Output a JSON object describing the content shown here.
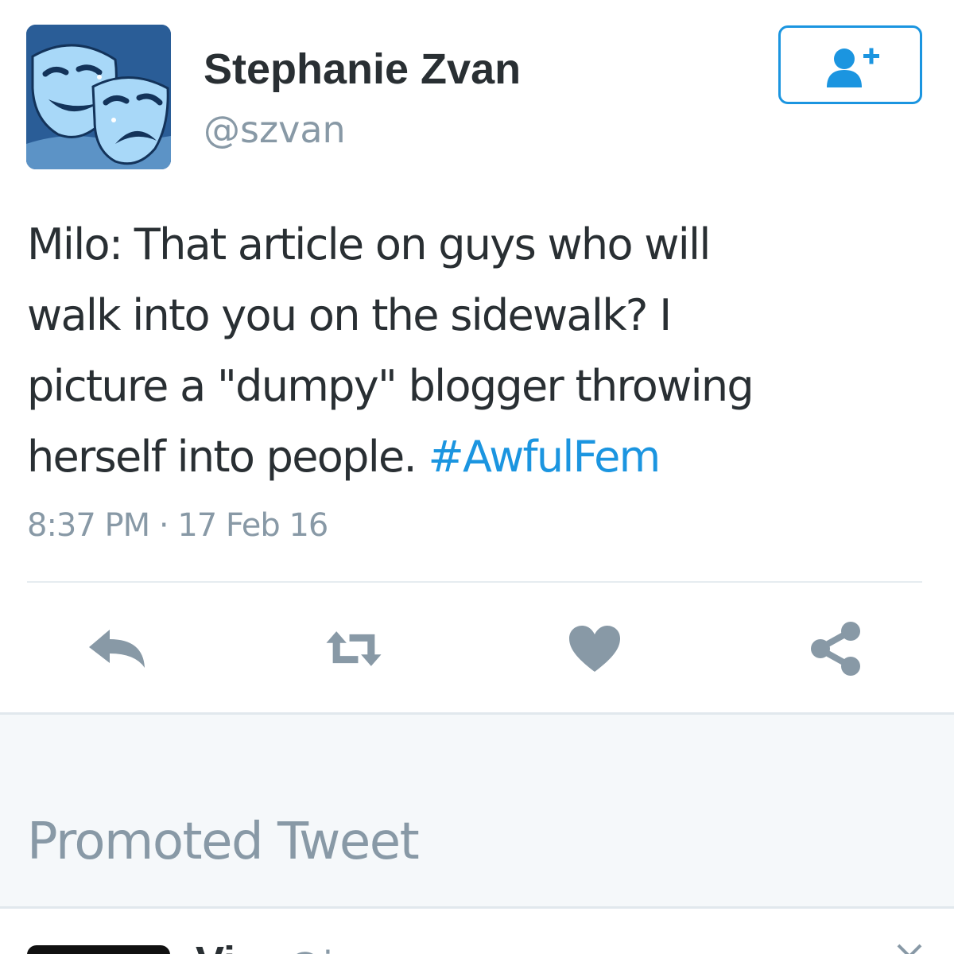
{
  "tweet": {
    "author": {
      "display_name": "Stephanie Zvan",
      "handle": "@szvan",
      "avatar_icon": "theater-masks-icon"
    },
    "follow_button": {
      "icon": "add-user-icon"
    },
    "text_lines": [
      "Milo: That article on guys who will",
      "walk into you on the sidewalk? I",
      "picture a \"dumpy\" blogger throwing",
      "herself into people. "
    ],
    "hashtag": "#AwfulFem",
    "timestamp": "8:37 PM · 17 Feb 16",
    "actions": [
      {
        "name": "reply",
        "icon": "reply-icon"
      },
      {
        "name": "retweet",
        "icon": "retweet-icon"
      },
      {
        "name": "like",
        "icon": "heart-icon"
      },
      {
        "name": "share",
        "icon": "share-icon"
      }
    ]
  },
  "promoted_label": "Promoted Tweet",
  "next_tweet": {
    "name_partial": "Vi",
    "handle_partial": "@i",
    "dismiss_icon": "close-icon"
  },
  "colors": {
    "accent": "#1b95e0",
    "text": "#292f33",
    "muted": "#8899a6",
    "icon_gray": "#8899a6",
    "background_gap": "#f5f8fa",
    "avatar_bg": "#2a5d97"
  }
}
